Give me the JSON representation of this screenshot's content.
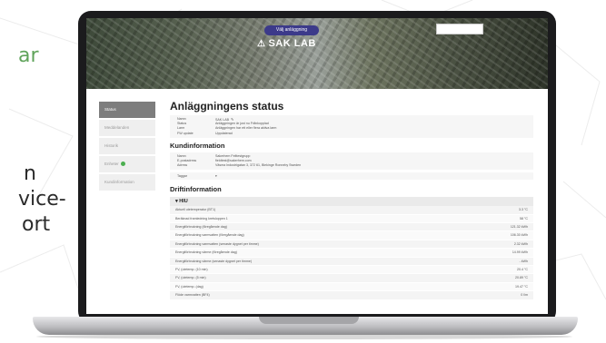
{
  "marketing": {
    "line1": "ar",
    "line2": "n",
    "line3": "vice-",
    "line4": "ort"
  },
  "hero": {
    "site_button": "Välj anläggning",
    "title": "SAK LAB"
  },
  "sidebar": {
    "items": [
      {
        "label": "Status"
      },
      {
        "label": "Meddelanden"
      },
      {
        "label": "Historik"
      },
      {
        "label": "Enheter"
      },
      {
        "label": "Kundinformation"
      }
    ]
  },
  "status": {
    "heading": "Anläggningens status",
    "rows": [
      {
        "k": "Namn",
        "v": "SAK LAB"
      },
      {
        "k": "Status",
        "v": "Anläggningen är just nu Frånkopplad"
      },
      {
        "k": "Larm",
        "v": "Anläggningen har ett eller flera aktiva larm"
      },
      {
        "k": "FW update",
        "v": "Uppdaterad"
      }
    ]
  },
  "kund": {
    "heading": "Kundinformation",
    "rows": [
      {
        "k": "Namn",
        "v": "Sakerhem Felttestgrupp"
      },
      {
        "k": "E-postadress",
        "v": "fieldtest@sakerhem.com"
      },
      {
        "k": "Adress",
        "v": "Väsma Industrigatan 3, 372 61, Blekinge Ronneby Sweden"
      }
    ],
    "tags_label": "Taggar"
  },
  "drift": {
    "heading": "Driftinformation",
    "section": "HIU",
    "rows": [
      {
        "k": "Aktuell utetemperatur (BT1)",
        "v": "3.3 °C"
      },
      {
        "k": "Beräknad framledning kretsloppen 1",
        "v": "58 °C"
      },
      {
        "k": "Energiförbrukning (föregående dag)",
        "v": "121.32 kWh"
      },
      {
        "k": "Energiförbrukning varmvatten (föregående dag)",
        "v": "106.30 kWh"
      },
      {
        "k": "Energiförbrukning varmvatten (senaste dygnet per timme)",
        "v": "2.32 kWh"
      },
      {
        "k": "Energiförbrukning värme (föregående dag)",
        "v": "14.99 kWh"
      },
      {
        "k": "Energiförbrukning värme (senaste dygnet per timme)",
        "v": "- kWh"
      },
      {
        "k": "FV, (utetemp. (10 min)",
        "v": "20.4 °C"
      },
      {
        "k": "FV, (utetemp. (5 min)",
        "v": "20.89 °C"
      },
      {
        "k": "FV, (utetemp. (dag)",
        "v": "19.47 °C"
      },
      {
        "k": "Flöde varmvatten (BF4)",
        "v": "0 l/m"
      }
    ]
  }
}
